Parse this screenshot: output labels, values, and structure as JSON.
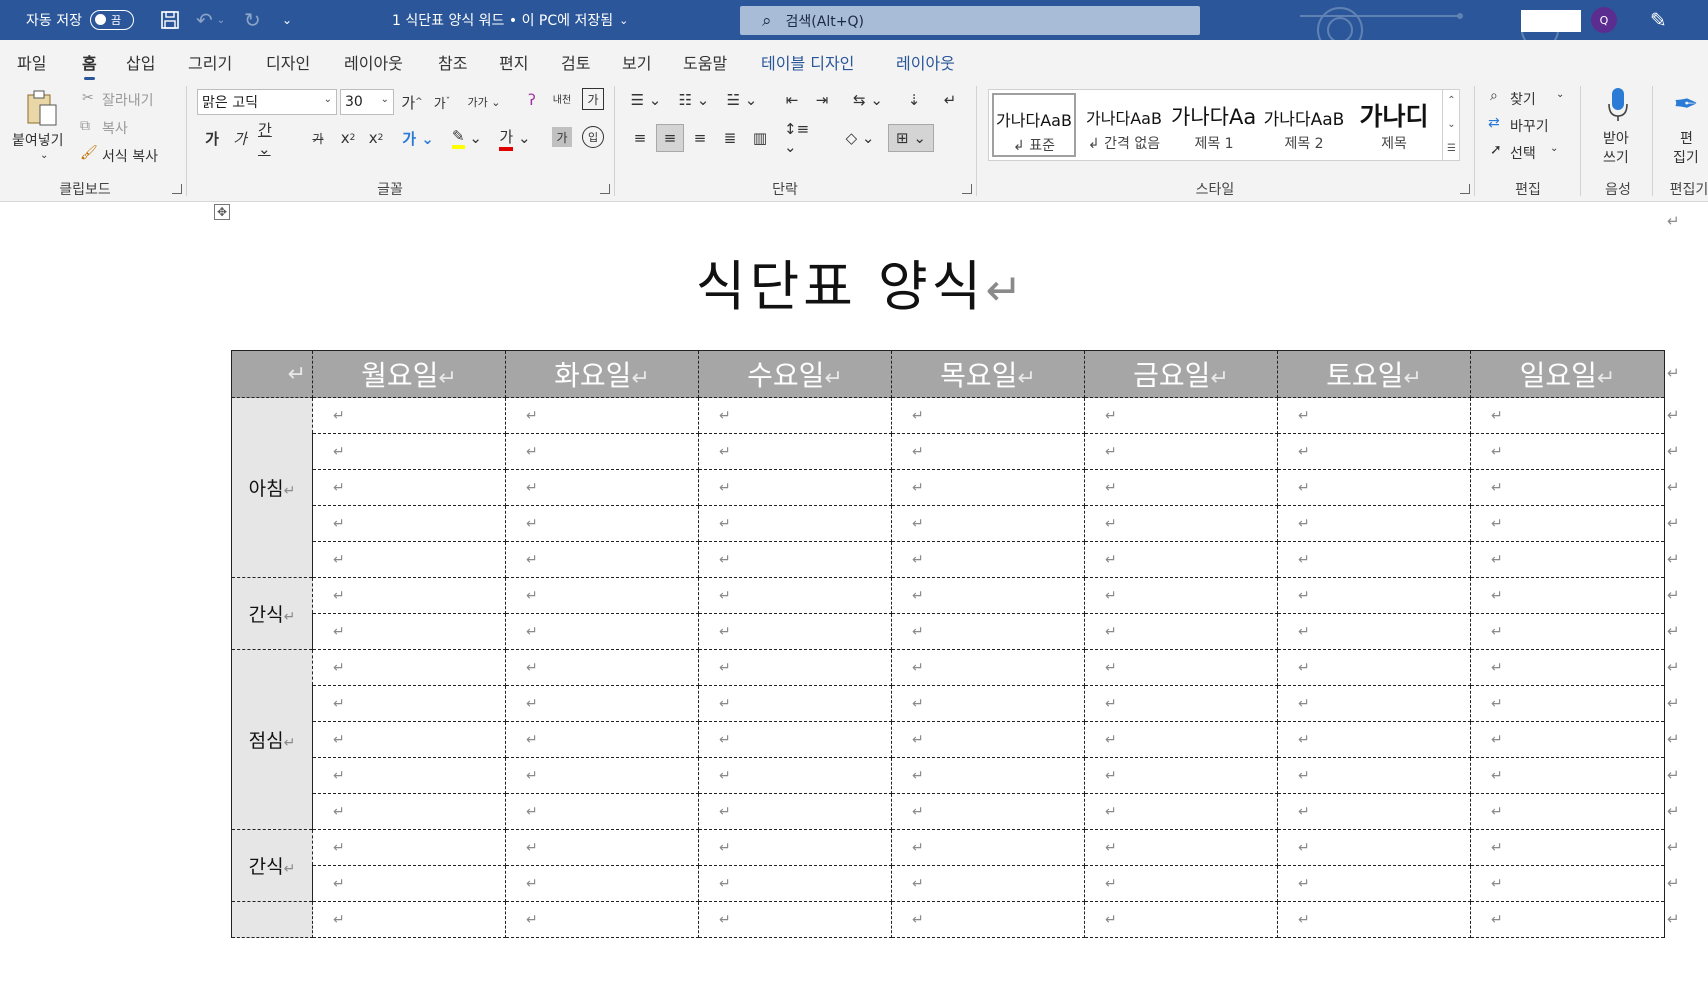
{
  "titlebar": {
    "autosave_label": "자동 저장",
    "autosave_state": "끔",
    "doc_title": "1 식단표 양식 워드 • 이 PC에 저장됨",
    "search_placeholder": "검색(Alt+Q)",
    "avatar_initial": "Q",
    "colors": {
      "bar": "#2b579a",
      "search": "#a8bcd8"
    }
  },
  "menu": {
    "tabs": [
      "파일",
      "홈",
      "삽입",
      "그리기",
      "디자인",
      "레이아웃",
      "참조",
      "편지",
      "검토",
      "보기",
      "도움말",
      "테이블 디자인",
      "레이아웃"
    ],
    "active_tab": "홈"
  },
  "ribbon": {
    "clipboard": {
      "paste": "붙여넣기",
      "cut": "잘라내기",
      "copy": "복사",
      "format_painter": "서식 복사",
      "label": "클립보드"
    },
    "font": {
      "font_name": "맑은 고딕",
      "font_size": "30",
      "label": "글꼴"
    },
    "paragraph": {
      "label": "단락"
    },
    "styles": {
      "label": "스타일",
      "items": [
        {
          "sample": "가나다AaB",
          "name": "↲ 표준"
        },
        {
          "sample": "가나다AaB",
          "name": "↲ 간격 없음"
        },
        {
          "sample": "가나다AaB",
          "name": "제목 1"
        },
        {
          "sample": "가나다AaB",
          "name": "제목 2"
        },
        {
          "sample": "가나디",
          "name": "제목"
        }
      ]
    },
    "editing": {
      "find": "찾기",
      "replace": "바꾸기",
      "select": "선택",
      "label": "편집"
    },
    "voice": {
      "dictate_1": "받아",
      "dictate_2": "쓰기",
      "label": "음성"
    },
    "editor": {
      "text_1": "편",
      "text_2": "집기",
      "label": "편집기"
    }
  },
  "document": {
    "title": "식단표 양식",
    "paragraph_mark": "↵",
    "days": [
      "월요일",
      "화요일",
      "수요일",
      "목요일",
      "금요일",
      "토요일",
      "일요일"
    ],
    "meals": [
      {
        "label": "아침",
        "rows": 5
      },
      {
        "label": "간식",
        "rows": 2
      },
      {
        "label": "점심",
        "rows": 5
      },
      {
        "label": "간식",
        "rows": 2
      },
      {
        "label": "",
        "rows": 1
      }
    ],
    "colors": {
      "header_fill": "#a6a6a6",
      "label_fill": "#e7e6e6"
    }
  }
}
